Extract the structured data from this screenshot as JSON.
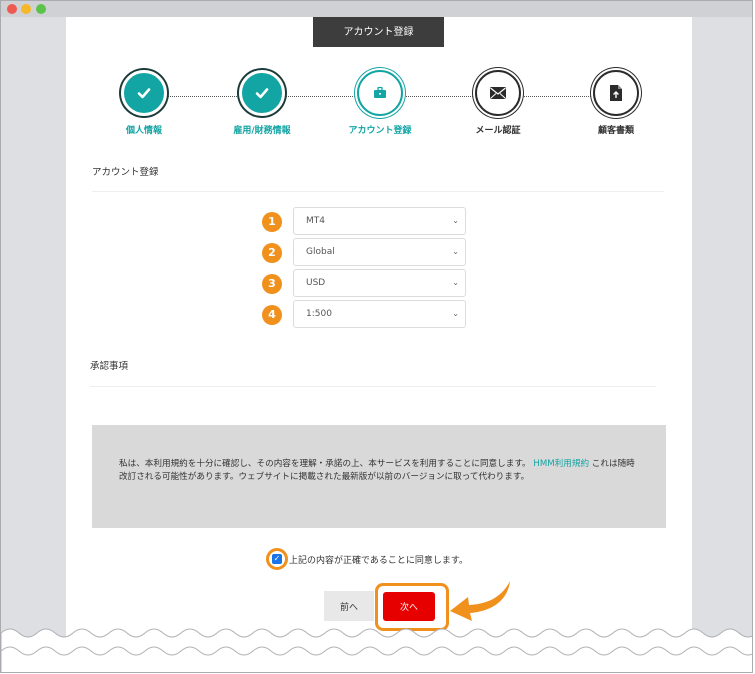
{
  "page_title": "アカウント登録",
  "steps": [
    {
      "label": "個人情報",
      "status": "done",
      "icon": "check-icon"
    },
    {
      "label": "雇用/財務情報",
      "status": "done",
      "icon": "check-icon"
    },
    {
      "label": "アカウント登録",
      "status": "current",
      "icon": "briefcase-icon"
    },
    {
      "label": "メール認証",
      "status": "todo",
      "icon": "envelope-icon"
    },
    {
      "label": "顧客書類",
      "status": "todo",
      "icon": "document-upload-icon"
    }
  ],
  "account_section": {
    "heading": "アカウント登録",
    "fields": [
      {
        "number": "1",
        "value": "MT4"
      },
      {
        "number": "2",
        "value": "Global"
      },
      {
        "number": "3",
        "value": "USD"
      },
      {
        "number": "4",
        "value": "1:500"
      }
    ]
  },
  "approval_section": {
    "heading": "承認事項"
  },
  "terms": {
    "text_before": "私は、本利用規約を十分に確認し、その内容を理解・承諾の上、本サービスを利用することに同意します。",
    "link": "HMM利用規約",
    "text_after": "これは随時改訂される可能性があります。ウェブサイトに掲載された最新版が以前のバージョンに取って代わります。"
  },
  "agree": {
    "label": "上記の内容が正確であることに同意します。",
    "checked": true
  },
  "buttons": {
    "prev": "前へ",
    "next": "次へ"
  },
  "colors": {
    "teal": "#13a4a4",
    "orange": "#f0911e",
    "red": "#e60000",
    "terms_bg": "#d9d9d9"
  }
}
